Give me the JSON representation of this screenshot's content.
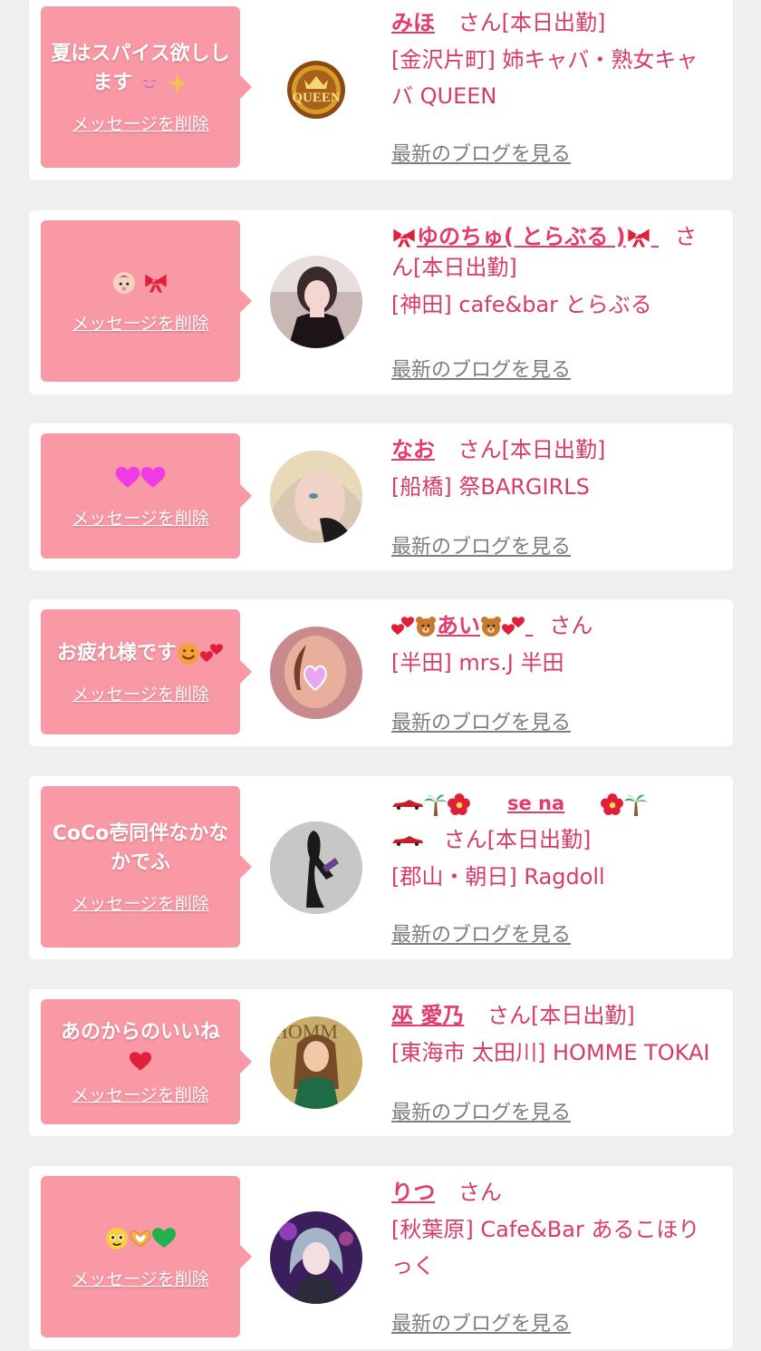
{
  "common": {
    "delete_label": "メッセージを削除",
    "blog_label": "最新のブログを見る",
    "san": "さん"
  },
  "items": [
    {
      "message": "夏はスパイス欲しします",
      "name": "みほ",
      "status": "[本日出勤]",
      "area": "[金沢片町]",
      "shop": "姉キャバ・熟女キャバ QUEEN",
      "avatar": "queen-logo"
    },
    {
      "message": "",
      "name": "ゆのちゅ( とらぶる )",
      "status": "[本日出勤]",
      "area": "[神田]",
      "shop": "cafe&bar とらぶる",
      "avatar": "photo-woman-1"
    },
    {
      "message": "",
      "name": "なお",
      "status": "[本日出勤]",
      "area": "[船橋]",
      "shop": "祭BARGIRLS",
      "avatar": "photo-woman-2"
    },
    {
      "message": "お疲れ様です",
      "name": "あい",
      "status": "",
      "area": "[半田]",
      "shop": "mrs.J 半田",
      "avatar": "photo-woman-3"
    },
    {
      "message": "CoCo壱同伴なかなかでふ",
      "name": "se na",
      "status": "[本日出勤]",
      "area": "[郡山・朝日]",
      "shop": "Ragdoll",
      "avatar": "photo-woman-4"
    },
    {
      "message": "あのからのいいね",
      "name": "巫 愛乃",
      "status": "[本日出勤]",
      "area": "[東海市 太田川]",
      "shop": "HOMME TOKAI",
      "avatar": "photo-woman-5"
    },
    {
      "message": "",
      "name": "りつ",
      "status": "",
      "area": "[秋葉原]",
      "shop": "Cafe&Bar あるこほりっく",
      "avatar": "photo-woman-6"
    }
  ]
}
